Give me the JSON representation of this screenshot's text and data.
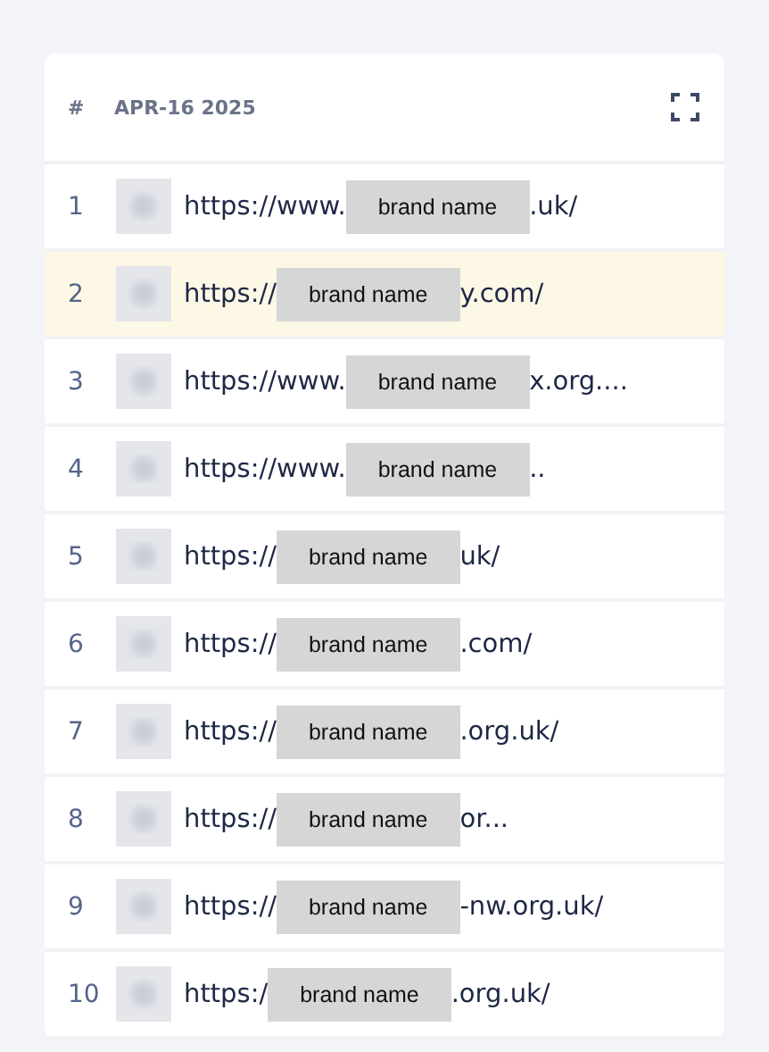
{
  "table": {
    "columns": [
      {
        "label": "#"
      },
      {
        "label": "APR-16 2025"
      }
    ],
    "rows": [
      {
        "rank": "1",
        "url_start": "https://www.",
        "redaction": "brand name",
        "url_end": ".uk/",
        "selected": false
      },
      {
        "rank": "2",
        "url_start": "https://",
        "redaction": "brand name",
        "url_end": "y.com/",
        "selected": true
      },
      {
        "rank": "3",
        "url_start": "https://www.",
        "redaction": "brand name",
        "url_end": "x.org....",
        "selected": false
      },
      {
        "rank": "4",
        "url_start": "https://www.",
        "redaction": "brand name",
        "url_end": "..",
        "selected": false
      },
      {
        "rank": "5",
        "url_start": "https://",
        "redaction": "brand name",
        "url_end": "uk/",
        "selected": false
      },
      {
        "rank": "6",
        "url_start": "https://",
        "redaction": "brand name",
        "url_end": ".com/",
        "selected": false
      },
      {
        "rank": "7",
        "url_start": "https://",
        "redaction": "brand name",
        "url_end": ".org.uk/",
        "selected": false
      },
      {
        "rank": "8",
        "url_start": "https://",
        "redaction": "brand name",
        "url_end": "or...",
        "selected": false
      },
      {
        "rank": "9",
        "url_start": "https://",
        "redaction": "brand name",
        "url_end": "-nw.org.uk/",
        "selected": false
      },
      {
        "rank": "10",
        "url_start": "https:/",
        "redaction": "brand name",
        "url_end": ".org.uk/",
        "selected": false
      }
    ]
  }
}
